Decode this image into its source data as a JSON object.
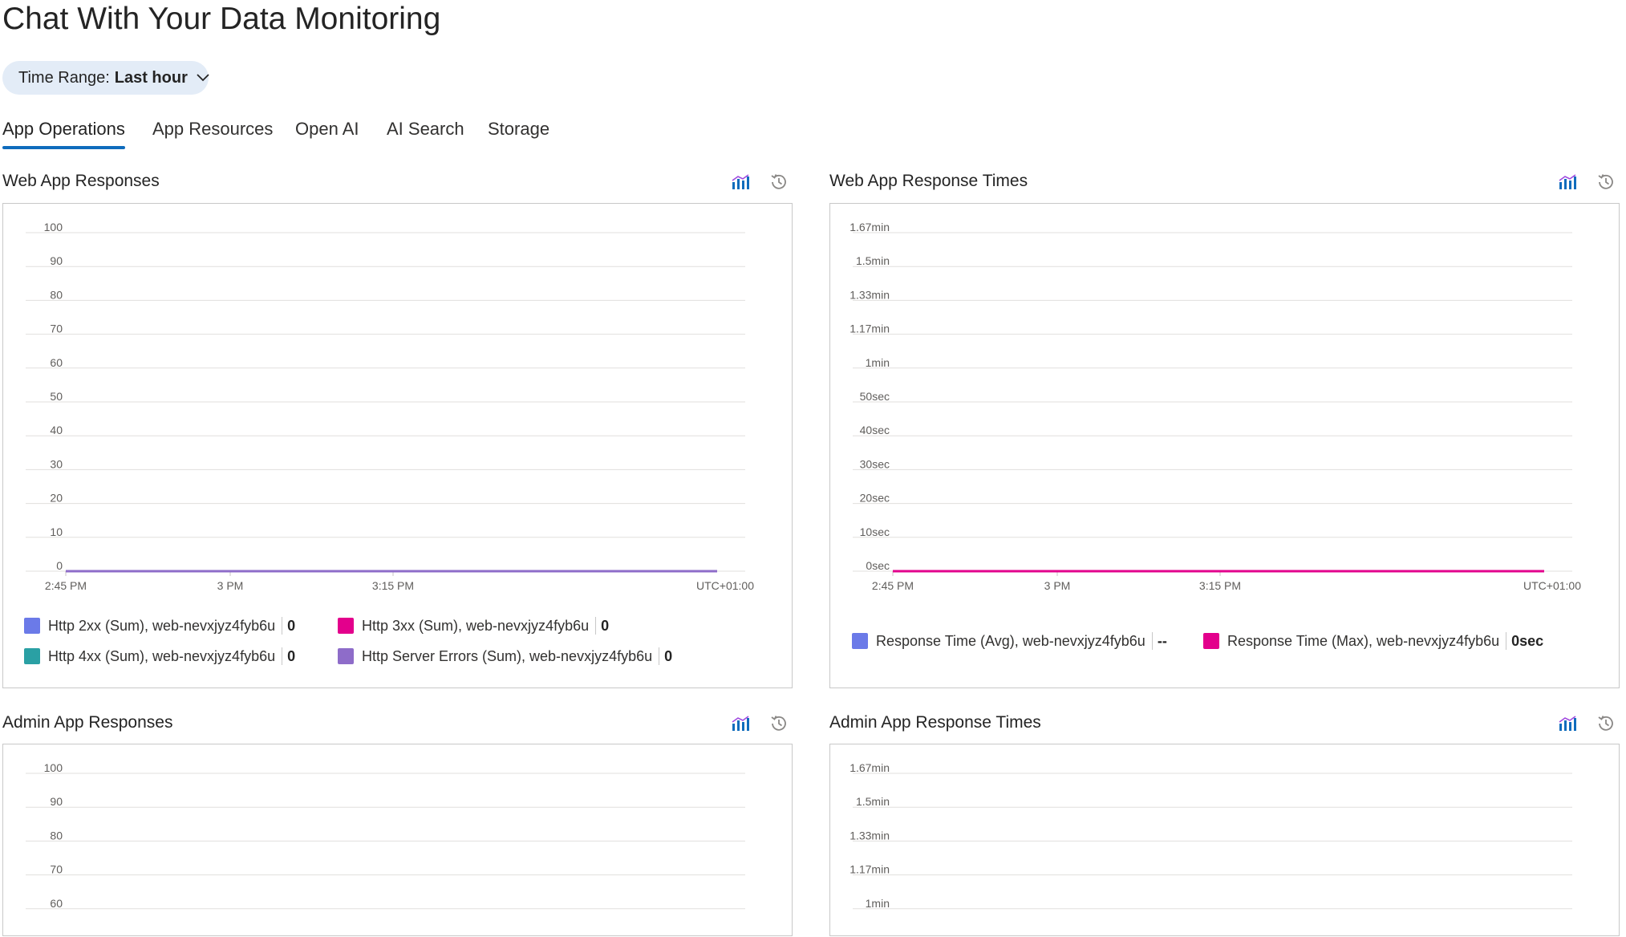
{
  "page": {
    "title": "Chat With Your Data Monitoring"
  },
  "time_range": {
    "label": "Time Range:",
    "value": "Last hour",
    "icon": "chevron-down-icon"
  },
  "tabs": [
    {
      "label": "App Operations",
      "active": true
    },
    {
      "label": "App Resources",
      "active": false
    },
    {
      "label": "Open AI",
      "active": false
    },
    {
      "label": "AI Search",
      "active": false
    },
    {
      "label": "Storage",
      "active": false
    }
  ],
  "panel_icons": {
    "metrics": "chart-icon",
    "history": "history-icon"
  },
  "colors": {
    "accent": "#0f6cbd",
    "http2xx": "#6b7ae8",
    "http3xx": "#e3008c",
    "http4xx": "#2aa0a4",
    "server_errors": "#8e6cc9",
    "resp_avg": "#6b7ae8",
    "resp_max": "#e3008c"
  },
  "panels": {
    "web_responses": {
      "title": "Web App Responses",
      "legend": [
        {
          "label": "Http 2xx (Sum), web-nevxjyz4fyb6u",
          "value": "0"
        },
        {
          "label": "Http 3xx (Sum), web-nevxjyz4fyb6u",
          "value": "0"
        },
        {
          "label": "Http 4xx (Sum), web-nevxjyz4fyb6u",
          "value": "0"
        },
        {
          "label": "Http Server Errors (Sum), web-nevxjyz4fyb6u",
          "value": "0"
        }
      ]
    },
    "web_times": {
      "title": "Web App Response Times",
      "legend": [
        {
          "label": "Response Time (Avg), web-nevxjyz4fyb6u",
          "value": "--"
        },
        {
          "label": "Response Time (Max), web-nevxjyz4fyb6u",
          "value": "0sec"
        }
      ]
    },
    "admin_responses": {
      "title": "Admin App Responses"
    },
    "admin_times": {
      "title": "Admin App Response Times"
    }
  },
  "chart_data": [
    {
      "id": "web_responses",
      "type": "line",
      "title": "Web App Responses",
      "x_ticks": [
        "2:45 PM",
        "3 PM",
        "3:15 PM"
      ],
      "timezone": "UTC+01:00",
      "y_ticks": [
        "100",
        "90",
        "80",
        "70",
        "60",
        "50",
        "40",
        "30",
        "20",
        "10",
        "0"
      ],
      "ylim": [
        0,
        100
      ],
      "grid": true,
      "legend_position": "bottom",
      "series": [
        {
          "name": "Http 2xx (Sum), web-nevxjyz4fyb6u",
          "values": [
            0,
            0
          ],
          "color": "#6b7ae8"
        },
        {
          "name": "Http 3xx (Sum), web-nevxjyz4fyb6u",
          "values": [
            0,
            0
          ],
          "color": "#e3008c"
        },
        {
          "name": "Http 4xx (Sum), web-nevxjyz4fyb6u",
          "values": [
            0,
            0
          ],
          "color": "#2aa0a4"
        },
        {
          "name": "Http Server Errors (Sum), web-nevxjyz4fyb6u",
          "values": [
            0,
            0
          ],
          "color": "#8e6cc9"
        }
      ]
    },
    {
      "id": "web_times",
      "type": "line",
      "title": "Web App Response Times",
      "x_ticks": [
        "2:45 PM",
        "3 PM",
        "3:15 PM"
      ],
      "timezone": "UTC+01:00",
      "y_ticks": [
        "1.67min",
        "1.5min",
        "1.33min",
        "1.17min",
        "1min",
        "50sec",
        "40sec",
        "30sec",
        "20sec",
        "10sec",
        "0sec"
      ],
      "ylim": [
        0,
        100
      ],
      "grid": true,
      "legend_position": "bottom",
      "series": [
        {
          "name": "Response Time (Avg), web-nevxjyz4fyb6u",
          "values": [],
          "color": "#6b7ae8"
        },
        {
          "name": "Response Time (Max), web-nevxjyz4fyb6u",
          "values": [
            0,
            0
          ],
          "color": "#e3008c"
        }
      ]
    },
    {
      "id": "admin_responses",
      "type": "line",
      "title": "Admin App Responses",
      "y_ticks": [
        "100",
        "90",
        "80",
        "70",
        "60"
      ],
      "grid": true
    },
    {
      "id": "admin_times",
      "type": "line",
      "title": "Admin App Response Times",
      "y_ticks": [
        "1.67min",
        "1.5min",
        "1.33min",
        "1.17min",
        "1min"
      ],
      "grid": true
    }
  ]
}
